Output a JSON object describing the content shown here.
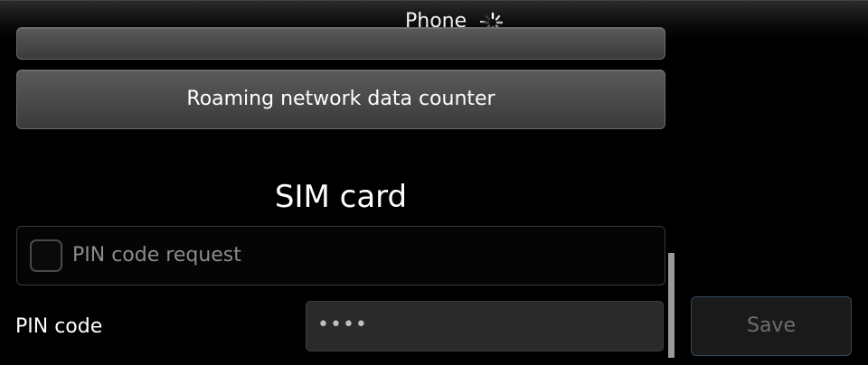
{
  "titlebar": {
    "title": "Phone",
    "dash": "-",
    "spinner_icon": "busy-spinner-icon"
  },
  "list": {
    "roaming_button_label": "Roaming network data counter"
  },
  "sim_section": {
    "title": "SIM card",
    "pin_request_label": "PIN code request",
    "pin_request_checked": false,
    "pin_code_label": "PIN code",
    "pin_code_value": "••••",
    "save_label": "Save"
  },
  "colors": {
    "background": "#000000",
    "button_top": "#5a5a5a",
    "button_bottom": "#3a3a3a",
    "disabled_text": "#6e6e6e",
    "save_border": "#344a5a"
  }
}
